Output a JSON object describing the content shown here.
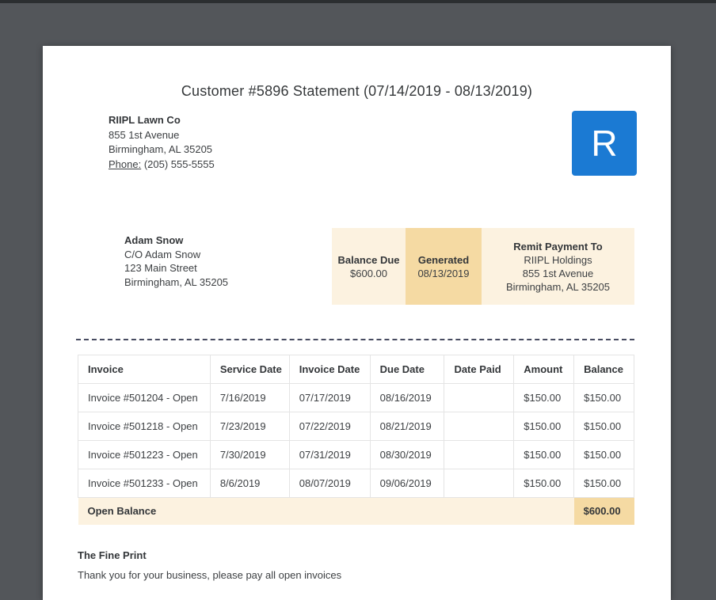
{
  "document": {
    "title": "Customer #5896 Statement (07/14/2019 - 08/13/2019)"
  },
  "company": {
    "name": "RIIPL Lawn Co",
    "address_line1": "855 1st Avenue",
    "address_line2": "Birmingham, AL 35205",
    "phone_label": "Phone:",
    "phone_number": "(205) 555-5555",
    "logo_letter": "R"
  },
  "customer": {
    "name": "Adam Snow",
    "care_of": "C/O Adam Snow",
    "address_line1": "123 Main Street",
    "address_line2": "Birmingham, AL 35205"
  },
  "summary": {
    "balance_due_label": "Balance Due",
    "balance_due_value": "$600.00",
    "generated_label": "Generated",
    "generated_value": "08/13/2019",
    "remit_label": "Remit Payment To",
    "remit_name": "RIIPL Holdings",
    "remit_address_line1": "855 1st Avenue",
    "remit_address_line2": "Birmingham, AL 35205"
  },
  "invoice_table": {
    "columns": [
      "Invoice",
      "Service Date",
      "Invoice Date",
      "Due Date",
      "Date Paid",
      "Amount",
      "Balance"
    ],
    "rows": [
      [
        "Invoice #501204 - Open",
        "7/16/2019",
        "07/17/2019",
        "08/16/2019",
        "",
        "$150.00",
        "$150.00"
      ],
      [
        "Invoice #501218 - Open",
        "7/23/2019",
        "07/22/2019",
        "08/21/2019",
        "",
        "$150.00",
        "$150.00"
      ],
      [
        "Invoice #501223 - Open",
        "7/30/2019",
        "07/31/2019",
        "08/30/2019",
        "",
        "$150.00",
        "$150.00"
      ],
      [
        "Invoice #501233 - Open",
        "8/6/2019",
        "08/07/2019",
        "09/06/2019",
        "",
        "$150.00",
        "$150.00"
      ]
    ],
    "footer_label": "Open Balance",
    "footer_total": "$600.00"
  },
  "fine_print": {
    "heading": "The Fine Print",
    "text": "Thank you for your business, please pay all open invoices"
  },
  "colors": {
    "background_gray": "#53565a",
    "brand_blue": "#1b7ad3",
    "highlight_light": "#fcf2e0",
    "highlight_dark": "#f5daa3"
  }
}
